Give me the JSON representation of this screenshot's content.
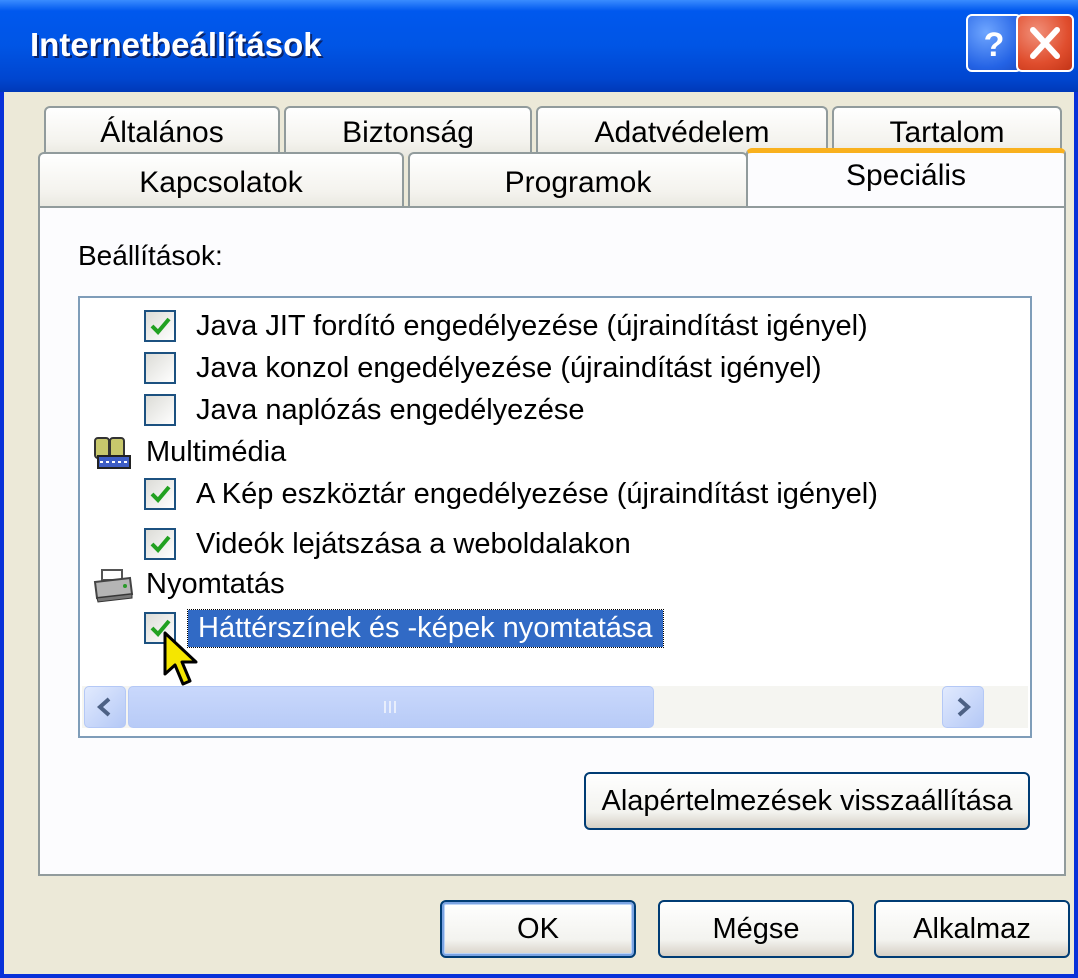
{
  "window": {
    "title": "Internetbeállítások",
    "help_label": "?",
    "close_label": "×"
  },
  "tabs": {
    "row1": [
      "Általános",
      "Biztonság",
      "Adatvédelem",
      "Tartalom"
    ],
    "row2": [
      "Kapcsolatok",
      "Programok",
      "Speciális"
    ],
    "active": "Speciális"
  },
  "settings_label": "Beállítások:",
  "settings_list": [
    {
      "type": "checkbox",
      "checked": true,
      "label": "Java JIT fordító engedélyezése (újraindítást igényel)"
    },
    {
      "type": "checkbox",
      "checked": false,
      "label": "Java konzol engedélyezése (újraindítást igényel)"
    },
    {
      "type": "checkbox",
      "checked": false,
      "label": "Java naplózás engedélyezése"
    },
    {
      "type": "group",
      "icon": "multimedia-icon",
      "label": "Multimédia"
    },
    {
      "type": "checkbox",
      "checked": true,
      "label": "A Kép eszköztár engedélyezése (újraindítást igényel)"
    },
    {
      "type": "checkbox",
      "checked": true,
      "label": "Videók lejátszása a weboldalakon"
    },
    {
      "type": "group",
      "icon": "printer-icon",
      "label": "Nyomtatás"
    },
    {
      "type": "checkbox",
      "checked": true,
      "selected": true,
      "label": "Háttérszínek és -képek nyomtatása"
    }
  ],
  "buttons": {
    "restore_defaults": "Alapértelmezések visszaállítása",
    "ok": "OK",
    "cancel": "Mégse",
    "apply": "Alkalmaz"
  },
  "colors": {
    "title_bar": "#0055E5",
    "active_tab_accent": "#F9B11E",
    "selection": "#316AC5",
    "checkmark": "#21A121"
  }
}
